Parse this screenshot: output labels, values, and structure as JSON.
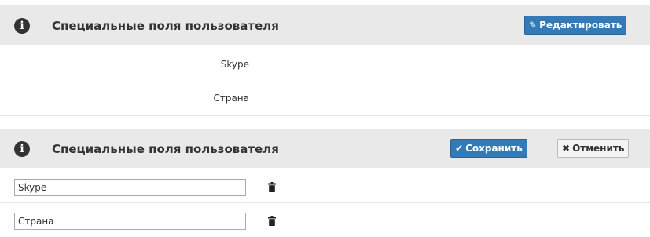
{
  "view_panel": {
    "title": "Специальные поля пользователя",
    "edit_label": "Редактировать",
    "edit_icon": "pencil-icon",
    "fields": [
      {
        "label": "Skype"
      },
      {
        "label": "Страна"
      }
    ]
  },
  "edit_panel": {
    "title": "Специальные поля пользователя",
    "save_label": "Сохранить",
    "save_icon": "check-icon",
    "cancel_label": "Отменить",
    "cancel_icon": "close-icon",
    "fields": [
      {
        "value": "Skype",
        "delete_icon": "trash-icon"
      },
      {
        "value": "Страна",
        "delete_icon": "trash-icon"
      }
    ]
  },
  "colors": {
    "header_bg": "#e9e9e9",
    "primary_button": "#337ab7",
    "default_button": "#f4f4f4"
  }
}
